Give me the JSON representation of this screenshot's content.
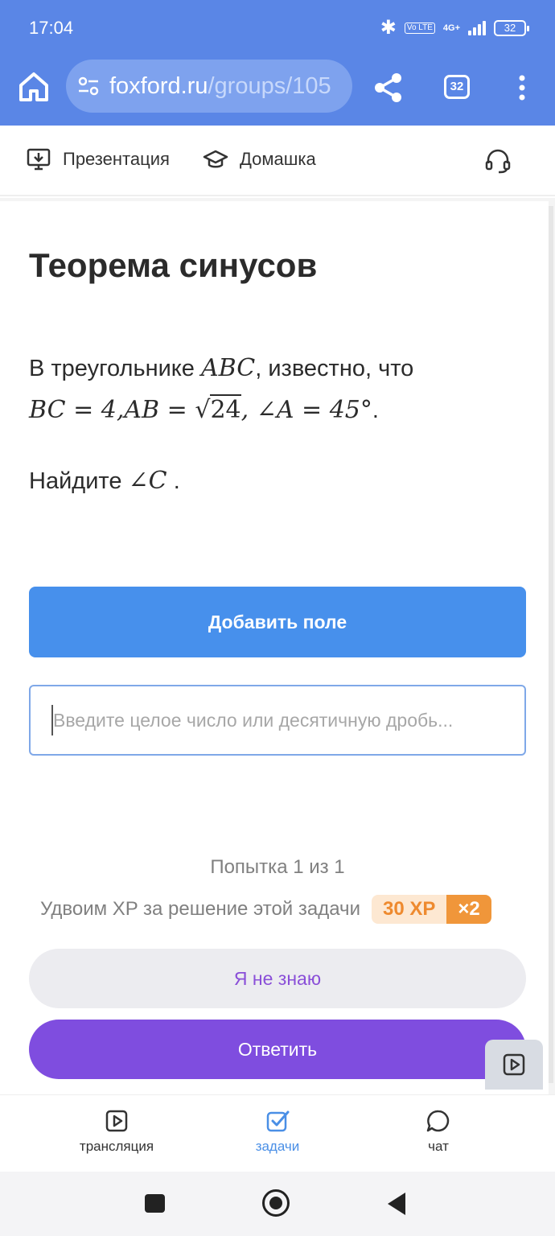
{
  "status_bar": {
    "time": "17:04",
    "network": "4G+",
    "volte": "Vo LTE",
    "battery": "32"
  },
  "browser": {
    "url_host": "foxford.ru",
    "url_path": "/groups/105",
    "tab_count": "32"
  },
  "header": {
    "presentation": "Презентация",
    "homework": "Домашка"
  },
  "task": {
    "title": "Теорема синусов",
    "intro": "В треугольнике ",
    "tri": "ABC",
    "known": ", известно, что",
    "bc": "BC = 4,",
    "ab": "AB = ",
    "sqrt_val": "24",
    "angle_a": ", ∠A = 45°",
    "period": ".",
    "question": "Найдите ",
    "angle_c": "∠C",
    "question_end": " ."
  },
  "form": {
    "add_field": "Добавить поле",
    "input_placeholder": "Введите целое число или десятичную дробь..."
  },
  "footer": {
    "attempt": "Попытка 1 из 1",
    "xp_text": "Удвоим XP за решение этой задачи",
    "xp_value": "30 XP",
    "xp_mult": "×2",
    "dont_know": "Я не знаю",
    "submit": "Ответить"
  },
  "tabbar": {
    "translation": "трансляция",
    "tasks": "задачи",
    "chat": "чат"
  },
  "colors": {
    "browser_bar": "#5a86e6",
    "primary_blue": "#4790ec",
    "submit_purple": "#7f4ddf",
    "xp_orange": "#f0963a"
  }
}
